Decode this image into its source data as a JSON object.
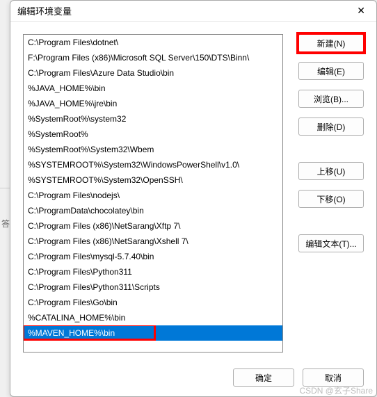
{
  "dialog": {
    "title": "编辑环境变量",
    "close_icon": "✕"
  },
  "list": {
    "items": [
      "C:\\Program Files\\dotnet\\",
      "F:\\Program Files (x86)\\Microsoft SQL Server\\150\\DTS\\Binn\\",
      "C:\\Program Files\\Azure Data Studio\\bin",
      "%JAVA_HOME%\\bin",
      "%JAVA_HOME%\\jre\\bin",
      "%SystemRoot%\\system32",
      "%SystemRoot%",
      "%SystemRoot%\\System32\\Wbem",
      "%SYSTEMROOT%\\System32\\WindowsPowerShell\\v1.0\\",
      "%SYSTEMROOT%\\System32\\OpenSSH\\",
      "C:\\Program Files\\nodejs\\",
      "C:\\ProgramData\\chocolatey\\bin",
      "C:\\Program Files (x86)\\NetSarang\\Xftp 7\\",
      "C:\\Program Files (x86)\\NetSarang\\Xshell 7\\",
      "C:\\Program Files\\mysql-5.7.40\\bin",
      "C:\\Program Files\\Python311",
      "C:\\Program Files\\Python311\\Scripts",
      "C:\\Program Files\\Go\\bin",
      "%CATALINA_HOME%\\bin",
      "%MAVEN_HOME%\\bin"
    ],
    "selected_index": 19
  },
  "buttons": {
    "new": "新建(N)",
    "edit": "编辑(E)",
    "browse": "浏览(B)...",
    "delete": "删除(D)",
    "move_up": "上移(U)",
    "move_down": "下移(O)",
    "edit_text": "编辑文本(T)...",
    "ok": "确定",
    "cancel": "取消"
  },
  "watermark": "CSDN @玄子Share",
  "bg_char": "答"
}
